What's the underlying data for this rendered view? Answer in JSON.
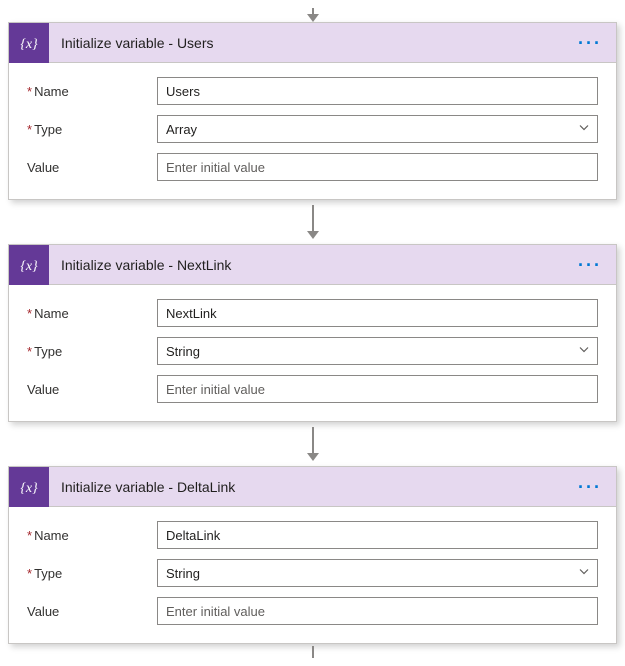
{
  "labels": {
    "name": "Name",
    "type": "Type",
    "value": "Value",
    "valuePlaceholder": "Enter initial value"
  },
  "cards": [
    {
      "title": "Initialize variable - Users",
      "name": "Users",
      "type": "Array",
      "value": ""
    },
    {
      "title": "Initialize variable - NextLink",
      "name": "NextLink",
      "type": "String",
      "value": ""
    },
    {
      "title": "Initialize variable - DeltaLink",
      "name": "DeltaLink",
      "type": "String",
      "value": ""
    }
  ]
}
